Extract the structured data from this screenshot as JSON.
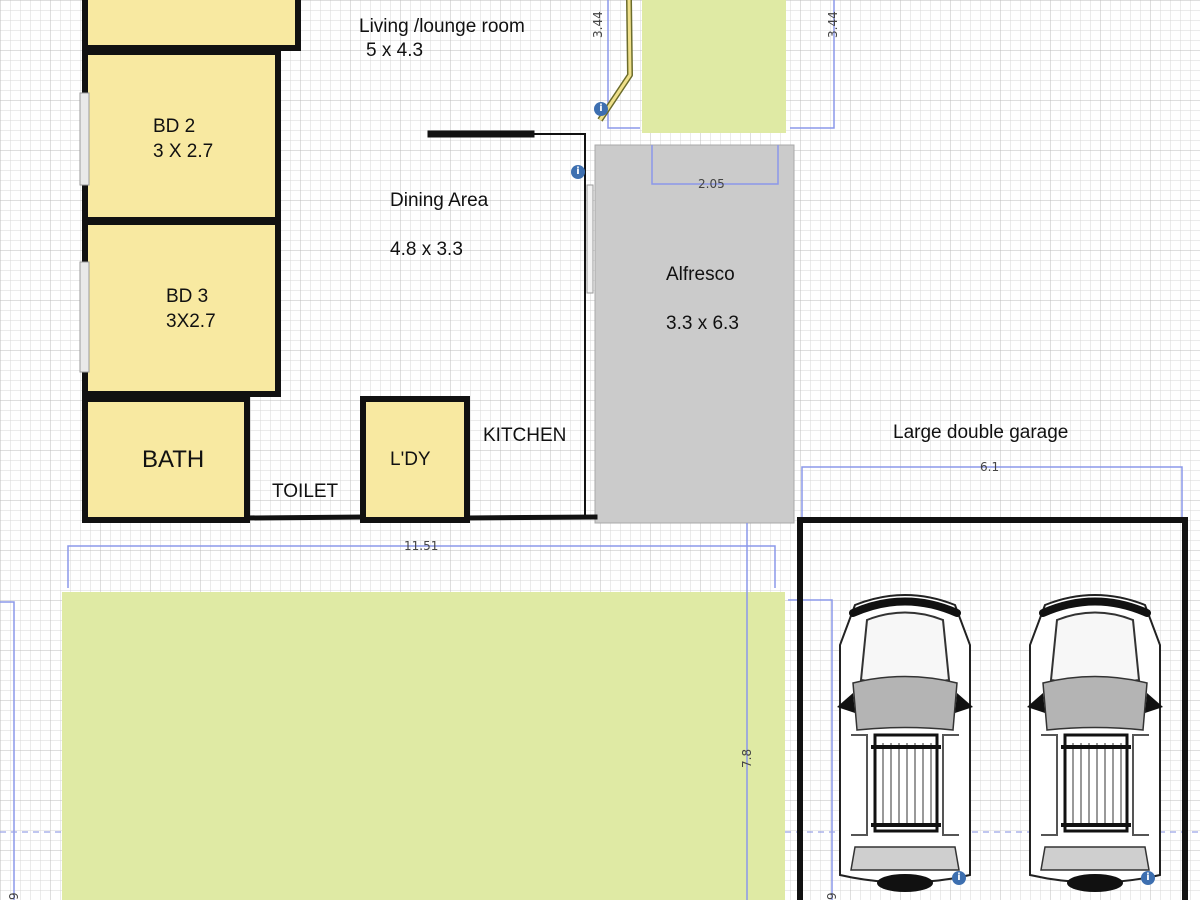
{
  "rooms": {
    "living": {
      "name": "Living /lounge room",
      "size": "5 x 4.3"
    },
    "bd2": {
      "name": "BD 2",
      "size": "3 X 2.7"
    },
    "bd3": {
      "name": "BD 3",
      "size": "3X2.7"
    },
    "dining": {
      "name": "Dining Area",
      "size": "4.8 x 3.3"
    },
    "alfresco": {
      "name": "Alfresco",
      "size": "3.3 x 6.3"
    },
    "bath": {
      "name": "BATH"
    },
    "toilet": {
      "name": "TOILET"
    },
    "laundry": {
      "name": "L'DY"
    },
    "kitchen": {
      "name": "KITCHEN"
    },
    "garage": {
      "name": "Large double garage"
    }
  },
  "dimensions": {
    "top_left": "3.44",
    "top_right": "3.44",
    "alfresco_width": "2.05",
    "house_width": "11.51",
    "garage_width": "6.1",
    "yard_depth": "7.8",
    "left_edge": "9",
    "garage_left_edge": "9"
  },
  "icons": {
    "info": "i"
  },
  "colors": {
    "room_fill": "#f8e9a1",
    "lawn_fill": "#dfeaa4",
    "alfresco_fill": "#cfcfcf",
    "grid_line": "#cfcfcf",
    "dimension_line": "#8b98ea",
    "wall": "#111111"
  }
}
